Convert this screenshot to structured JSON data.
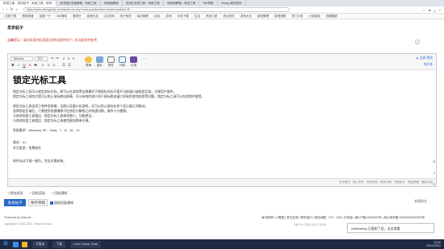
{
  "tabs": [
    {
      "label": "系统之家 - 发布帖子 - 系统工具，软件..."
    },
    {
      "label": "[系统相] 安装教程 - 系统之家"
    },
    {
      "label": "系统相教程"
    },
    {
      "label": "[在线] 系统之家 - 系统之家"
    },
    {
      "label": "系统相教程 - 系统之家"
    },
    {
      "label": "360导航"
    },
    {
      "label": "Oneqq 新标签页"
    }
  ],
  "address": {
    "url": "https://www.xitongzhijia.net/bbs/forum.php?mod=post&action=newthread&fid=39"
  },
  "bookmarks": [
    "应用下载",
    "宽带测速",
    "百度一下",
    "360搜索",
    "爱奇艺",
    "影视大全",
    "QQ空间",
    "电子商务",
    "每日推荐",
    "必应",
    "游戏",
    "手机下载",
    "生活",
    "系统之家",
    "热点资讯",
    "游戏大全",
    "新浪微博",
    "影视视频",
    "热门小说",
    "小说阅读",
    "视频播放"
  ],
  "page": {
    "forum_title": "发表帖子",
    "hint": "温馨提示：请勿发表违反国家法律法规的帖子 | 本页面仅供参考",
    "help": "?"
  },
  "toolbar": {
    "font_select": "Tahoma",
    "size_select": "大小",
    "icons": [
      "B",
      "I",
      "U",
      "A",
      "S",
      "≡",
      "≡",
      "≡",
      "☰",
      "☰"
    ],
    "big_buttons": [
      "表情",
      "图片",
      "附件",
      "代码",
      "引用"
    ],
    "right_top": "▲ 全屏  预览",
    "right_bottom": "纯文本"
  },
  "content": {
    "title": "锁定光标工具",
    "paragraphs": [
      "锁定光标工具可以锁定鼠标光标，即可以在游戏等全屏模式下使鼠标光标不离开当前窗口或指定区域，方便用户操作。",
      "锁定光标工具特点是可以防止鼠标跑出屏幕，可以有效的减少由于鼠标跑出窗口导致的游戏失败等问题，锁定光标工具可以在游戏中使用。",
      "",
      "锁定光标工具适用于各种多屏幕，全屏以及窗口化游戏，还可以防止鼠标在多个显示器之间移动。",
      "选择锁定区域后，只需使用快捷键即可在锁定与解锁之间快速切换，操作十分便捷。",
      "与其他同类工具相比，锁定光标工具体积更小，功能更全。",
      "与其他同类工具相比，锁定光标工具使用更加简单方便。"
    ],
    "system_req": "系统要求：Windows XP、Vista、7、8、10、11",
    "version": "版本：V1",
    "license": "许可类型：免费软件",
    "note": "软件自动下载一键为，完全无需安装。"
  },
  "editor_footer": [
    "文字格式",
    "插入附件",
    "发帖须知",
    "剩余字数",
    "字数统计",
    "恢复数据",
    "清除内容"
  ],
  "side_tools": [
    "≡",
    "⌕",
    "◐"
  ],
  "options": [
    "附加选项",
    "回帖奖励",
    "回帖通知"
  ],
  "post_button": "发表帖子",
  "draft_button": "保存草稿",
  "checkbox_label": "接收回复通知",
  "notice": "本版积分",
  "footer": {
    "powered": "Powered by Discuz!",
    "copyright": "Copyright © 2001-2021, Tencent Cloud.",
    "links": "每日推荐 | 小黑屋 | 意见反馈 | 联系我们 | 网站地图 · ICP · LBS | 手机版 | 闽ICP备10000000号 | 闽公网安备 35000000000000号",
    "time": "GMT+8, 2021-10-21 10:00"
  },
  "popup": "softsharing 已复制了此，点击查看",
  "taskbar": {
    "items": [
      "写版本",
      "下载",
      "Lock Cursor Tools"
    ],
    "clock": "10:00",
    "date": "2021/10/21"
  },
  "colors": {
    "accent": "#2b67c7",
    "taskbar": "#1e2a44",
    "hint": "#cc3333"
  }
}
